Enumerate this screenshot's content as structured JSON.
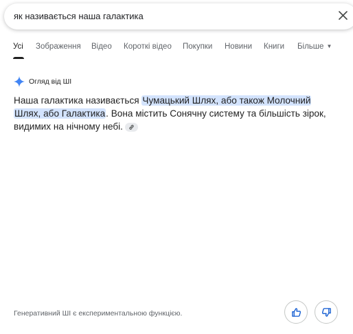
{
  "search": {
    "query": "як називається наша галактика"
  },
  "tabs": [
    {
      "label": "Усі"
    },
    {
      "label": "Зображення"
    },
    {
      "label": "Відео"
    },
    {
      "label": "Короткі відео"
    },
    {
      "label": "Покупки"
    },
    {
      "label": "Новини"
    },
    {
      "label": "Книги"
    },
    {
      "label": "Більше"
    }
  ],
  "ai_overview": {
    "title": "Огляд від ШІ",
    "answer_prefix": "Наша галактика називається ",
    "answer_highlight_line1": "Чумацький Шлях, або також Молочний",
    "answer_highlight_line2": "Шлях, або Галактика",
    "answer_suffix": ". Вона містить Сонячну систему та більшість зірок, видимих на нічному небі."
  },
  "footer": {
    "note": "Генеративний ШІ є експериментальною функцією."
  },
  "colors": {
    "highlight": "#d3e3fd",
    "accent_blue": "#4285f4"
  },
  "icons": {
    "clear": "close-icon",
    "ai": "sparkle-icon",
    "link": "link-icon",
    "like": "thumbs-up-icon",
    "dislike": "thumbs-down-icon"
  }
}
